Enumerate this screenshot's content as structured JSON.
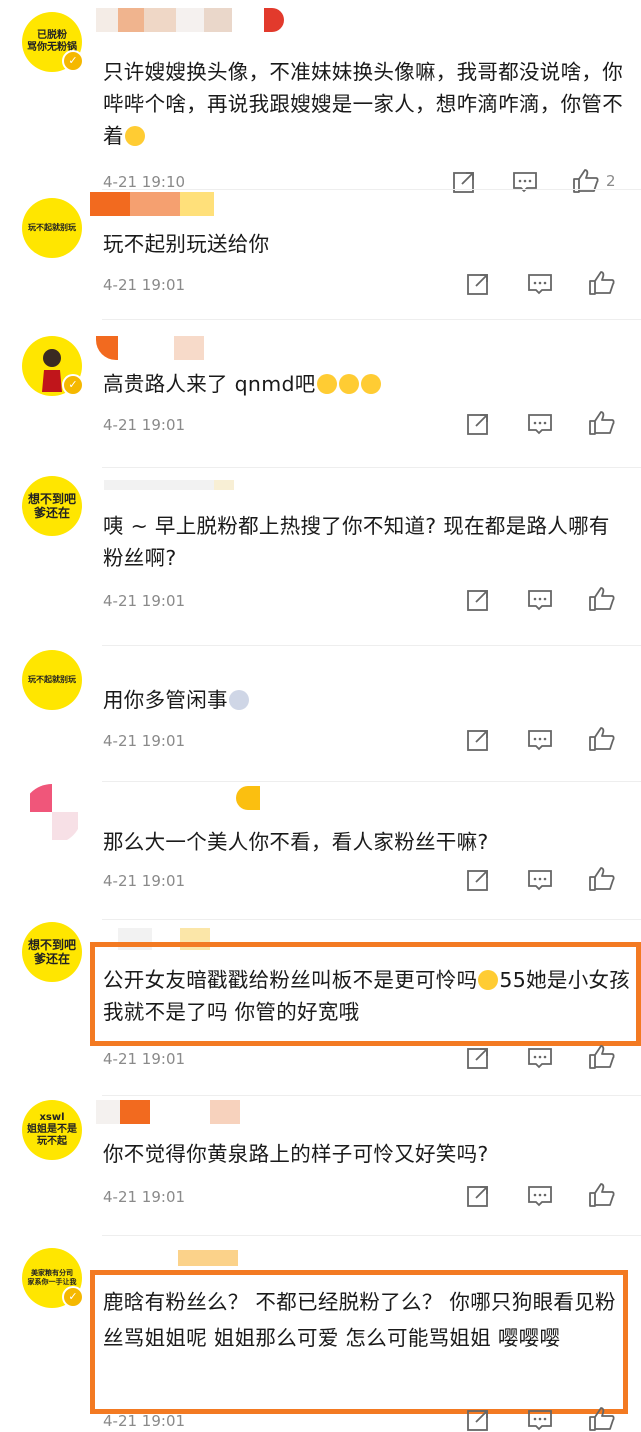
{
  "comments": [
    {
      "avatar_text": "已脱粉\n骂你无粉锅",
      "text": "只许嫂嫂换头像，不准妹妹换头像嘛，我哥都没说啥，你哔哔个啥，再说我跟嫂嫂是一家人，想咋滴咋滴，你管不着",
      "emoji": "😁",
      "time": "4-21 19:10",
      "likes": "2"
    },
    {
      "avatar_text": "玩不起就别玩",
      "text": "玩不起别玩送给你",
      "time": "4-21 19:01"
    },
    {
      "avatar_text": "",
      "text": "高贵路人来了 qnmd吧",
      "emoji": "😖😖😖",
      "time": "4-21 19:01"
    },
    {
      "avatar_text": "想不到吧\n爹还在",
      "text": "咦 ~ 早上脱粉都上热搜了你不知道? 现在都是路人哪有粉丝啊?",
      "time": "4-21 19:01"
    },
    {
      "avatar_text": "玩不起就别玩",
      "text": "用你多管闲事",
      "emoji": "🙄",
      "time": "4-21 19:01"
    },
    {
      "avatar_text": "",
      "text": "那么大一个美人你不看，看人家粉丝干嘛?",
      "time": "4-21 19:01"
    },
    {
      "avatar_text": "想不到吧\n爹还在",
      "text": "公开女友暗戳戳给粉丝叫板不是更可怜吗",
      "emoji": "😞",
      "text_after": "55她是小女孩我就不是了吗 你管的好宽哦",
      "time": "4-21 19:01"
    },
    {
      "avatar_text": "xswl\n姐姐是不是\n玩不起",
      "text": "你不觉得你黄泉路上的样子可怜又好笑吗?",
      "time": "4-21 19:01"
    },
    {
      "avatar_text": "美家粮有分司\n家系你一手让我",
      "text": "鹿晗有粉丝么？  不都已经脱粉了么？ 你哪只狗眼看见粉丝骂姐姐呢  姐姐那么可爱  怎么可能骂姐姐  嘤嘤嘤",
      "time": "4-21 19:01"
    }
  ],
  "icons": {
    "share": "share-icon",
    "comment": "comment-icon",
    "like": "thumbs-up-icon",
    "verified": "verified-badge-icon"
  },
  "colors": {
    "highlight": "#f37a22",
    "avatar_bg": "#ffe600",
    "badge": "#f5b800",
    "meta": "#8a8a8a"
  }
}
